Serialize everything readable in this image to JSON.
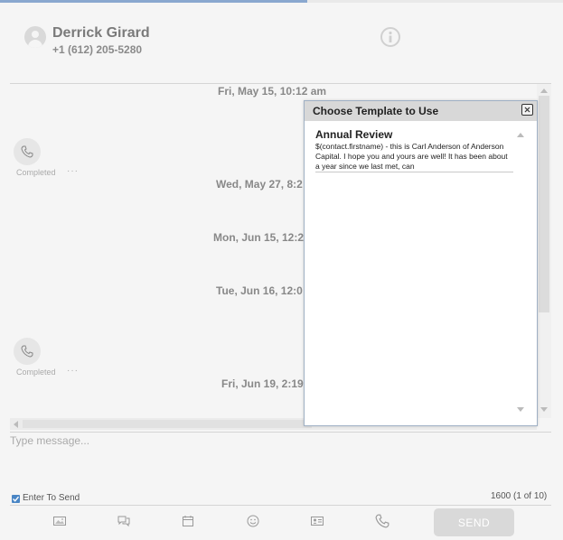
{
  "progress_fraction": 0.545,
  "header": {
    "contact_name": "Derrick Girard",
    "contact_phone": "+1 (612) 205-5280",
    "info_icon": "info-circle-icon"
  },
  "conversation": {
    "dates": [
      "Fri, May 15, 10:12 am",
      "Wed, May 27, 8:2",
      "Mon, Jun 15, 12:2",
      "Tue, Jun 16, 12:0",
      "Fri, Jun 19, 2:19"
    ],
    "calls": [
      {
        "status": "Completed",
        "more": "···",
        "icon": "phone-icon"
      },
      {
        "status": "Completed",
        "more": "···",
        "icon": "phone-icon"
      }
    ]
  },
  "composer": {
    "placeholder": "Type message...",
    "enter_to_send_label": "Enter To Send",
    "enter_to_send_checked": true,
    "char_counter": "1600 (1 of 10)",
    "send_label": "SEND",
    "toolbar_icons": [
      "image-icon",
      "chat-icon",
      "calendar-icon",
      "emoji-icon",
      "contact-card-icon",
      "phone-icon"
    ]
  },
  "template_modal": {
    "title": "Choose Template to Use",
    "templates": [
      {
        "title": "Annual Review",
        "preview": "$(contact.firstname) - this is Carl Anderson of Anderson Capital. I hope you and yours are well! It has been about a year since we last met, can"
      }
    ]
  },
  "colors": {
    "accent": "#4a86c5",
    "progress": "#8aa8cf",
    "background": "#f5f5f5",
    "send_disabled": "#d9d9d9"
  }
}
